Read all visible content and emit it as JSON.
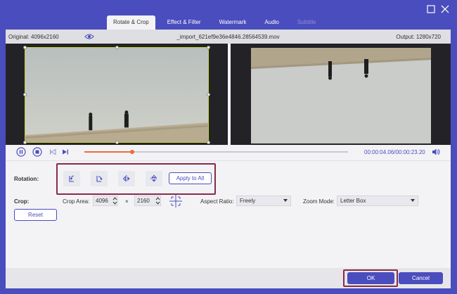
{
  "tabs": [
    {
      "label": "Rotate & Crop"
    },
    {
      "label": "Effect & Filter"
    },
    {
      "label": "Watermark"
    },
    {
      "label": "Audio"
    },
    {
      "label": "Subtitle"
    }
  ],
  "info": {
    "original": "Original: 4096x2160",
    "filename": "_import_621ef9e36e4846.28564539.mov",
    "output": "Output: 1280x720"
  },
  "player": {
    "timecode": "00:00:04.06/00:00:23.20",
    "progress": 0.18
  },
  "rotation": {
    "label": "Rotation:",
    "apply_all": "Apply to All"
  },
  "crop": {
    "label": "Crop:",
    "area_label": "Crop Area:",
    "width": "4096",
    "times": "×",
    "height": "2160",
    "aspect_label": "Aspect Ratio:",
    "aspect_value": "Freely",
    "zoom_label": "Zoom Mode:",
    "zoom_value": "Letter Box",
    "reset": "Reset"
  },
  "footer": {
    "ok": "OK",
    "cancel": "Cancel"
  },
  "colors": {
    "accent": "#4a4dbd",
    "highlight_border": "#8a2a4a",
    "progress": "#f06a3a"
  }
}
